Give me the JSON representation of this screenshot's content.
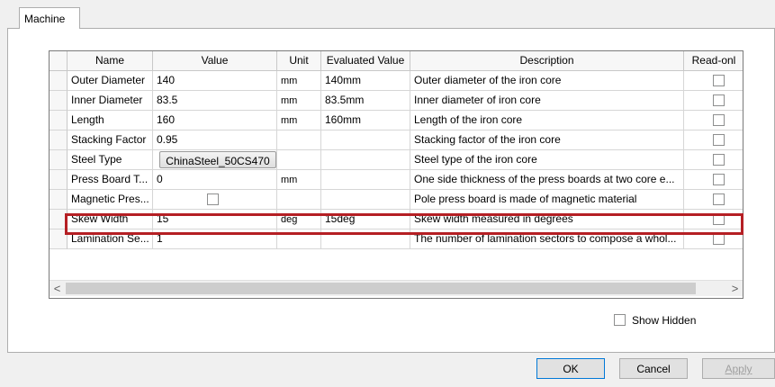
{
  "tab": {
    "label": "Machine"
  },
  "table": {
    "columns": [
      "Name",
      "Value",
      "Unit",
      "Evaluated Value",
      "Description",
      "Read-onl"
    ],
    "rows": [
      {
        "name": "Outer Diameter",
        "value": "140",
        "unit": "mm",
        "evaluated": "140mm",
        "description": "Outer diameter of the iron core",
        "read_only": false
      },
      {
        "name": "Inner Diameter",
        "value": "83.5",
        "unit": "mm",
        "evaluated": "83.5mm",
        "description": "Inner diameter of iron core",
        "read_only": false
      },
      {
        "name": "Length",
        "value": "160",
        "unit": "mm",
        "evaluated": "160mm",
        "description": "Length of the iron core",
        "read_only": false
      },
      {
        "name": "Stacking Factor",
        "value": "0.95",
        "unit": "",
        "evaluated": "",
        "description": "Stacking factor of the iron core",
        "read_only": false
      },
      {
        "name": "Steel Type",
        "value": "ChinaSteel_50CS470",
        "unit": "",
        "evaluated": "",
        "description": "Steel type of the iron core",
        "read_only": false
      },
      {
        "name": "Press Board T...",
        "value": "0",
        "unit": "mm",
        "evaluated": "",
        "description": "One side thickness of the press boards at two core e...",
        "read_only": false
      },
      {
        "name": "Magnetic Pres...",
        "value": "",
        "unit": "",
        "evaluated": "",
        "description": "Pole press board is made of magnetic material",
        "read_only": false
      },
      {
        "name": "Skew Width",
        "value": "15",
        "unit": "deg",
        "evaluated": "15deg",
        "description": "Skew width measured in degrees",
        "read_only": false
      },
      {
        "name": "Lamination Se...",
        "value": "1",
        "unit": "",
        "evaluated": "",
        "description": "The number of lamination sectors to compose a whol...",
        "read_only": false
      }
    ],
    "highlighted_row": "Skew Width"
  },
  "scrollbar": {
    "left_arrow": "<",
    "right_arrow": ">"
  },
  "show_hidden": {
    "label": "Show Hidden",
    "checked": false
  },
  "buttons": {
    "ok": "OK",
    "cancel": "Cancel",
    "apply": "Apply"
  },
  "colors": {
    "highlight": "#b51f24",
    "ok_border": "#0078d7"
  }
}
